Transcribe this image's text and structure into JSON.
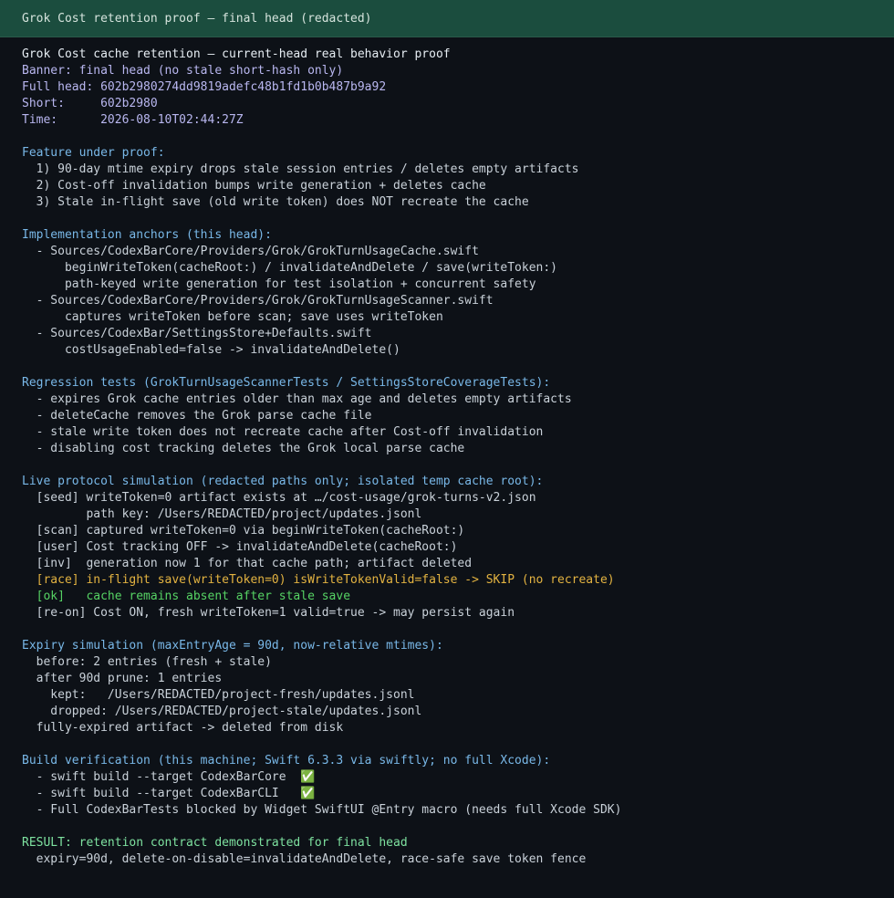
{
  "window": {
    "title": "Grok Cost retention proof — final head (redacted)"
  },
  "lines": [
    {
      "text": "Grok Cost cache retention — current-head real behavior proof",
      "color": "white"
    },
    {
      "text": "Banner: final head (no stale short-hash only)",
      "color": "lav"
    },
    {
      "text": "Full head: 602b2980274dd9819adefc48b1fd1b0b487b9a92",
      "color": "lav"
    },
    {
      "text": "Short:     602b2980",
      "color": "lav"
    },
    {
      "text": "Time:      2026-08-10T02:44:27Z",
      "color": "lav"
    },
    {
      "text": "",
      "color": "text"
    },
    {
      "text": "Feature under proof:",
      "color": "blue"
    },
    {
      "text": "  1) 90-day mtime expiry drops stale session entries / deletes empty artifacts",
      "color": "text"
    },
    {
      "text": "  2) Cost-off invalidation bumps write generation + deletes cache",
      "color": "text"
    },
    {
      "text": "  3) Stale in-flight save (old write token) does NOT recreate the cache",
      "color": "text"
    },
    {
      "text": "",
      "color": "text"
    },
    {
      "text": "Implementation anchors (this head):",
      "color": "blue"
    },
    {
      "text": "  - Sources/CodexBarCore/Providers/Grok/GrokTurnUsageCache.swift",
      "color": "text"
    },
    {
      "text": "      beginWriteToken(cacheRoot:) / invalidateAndDelete / save(writeToken:)",
      "color": "text"
    },
    {
      "text": "      path-keyed write generation for test isolation + concurrent safety",
      "color": "text"
    },
    {
      "text": "  - Sources/CodexBarCore/Providers/Grok/GrokTurnUsageScanner.swift",
      "color": "text"
    },
    {
      "text": "      captures writeToken before scan; save uses writeToken",
      "color": "text"
    },
    {
      "text": "  - Sources/CodexBar/SettingsStore+Defaults.swift",
      "color": "text"
    },
    {
      "text": "      costUsageEnabled=false -> invalidateAndDelete()",
      "color": "text"
    },
    {
      "text": "",
      "color": "text"
    },
    {
      "text": "Regression tests (GrokTurnUsageScannerTests / SettingsStoreCoverageTests):",
      "color": "blue"
    },
    {
      "text": "  - expires Grok cache entries older than max age and deletes empty artifacts",
      "color": "text"
    },
    {
      "text": "  - deleteCache removes the Grok parse cache file",
      "color": "text"
    },
    {
      "text": "  - stale write token does not recreate cache after Cost-off invalidation",
      "color": "text"
    },
    {
      "text": "  - disabling cost tracking deletes the Grok local parse cache",
      "color": "text"
    },
    {
      "text": "",
      "color": "text"
    },
    {
      "text": "Live protocol simulation (redacted paths only; isolated temp cache root):",
      "color": "blue"
    },
    {
      "text": "  [seed] writeToken=0 artifact exists at …/cost-usage/grok-turns-v2.json",
      "color": "text"
    },
    {
      "text": "         path key: /Users/REDACTED/project/updates.jsonl",
      "color": "text"
    },
    {
      "text": "  [scan] captured writeToken=0 via beginWriteToken(cacheRoot:)",
      "color": "text"
    },
    {
      "text": "  [user] Cost tracking OFF -> invalidateAndDelete(cacheRoot:)",
      "color": "text"
    },
    {
      "text": "  [inv]  generation now 1 for that cache path; artifact deleted",
      "color": "text"
    },
    {
      "text": "  [race] in-flight save(writeToken=0) isWriteTokenValid=false -> SKIP (no recreate)",
      "color": "yellow"
    },
    {
      "text": "  [ok]   cache remains absent after stale save",
      "color": "green"
    },
    {
      "text": "  [re-on] Cost ON, fresh writeToken=1 valid=true -> may persist again",
      "color": "text"
    },
    {
      "text": "",
      "color": "text"
    },
    {
      "text": "Expiry simulation (maxEntryAge = 90d, now-relative mtimes):",
      "color": "blue"
    },
    {
      "text": "  before: 2 entries (fresh + stale)",
      "color": "text"
    },
    {
      "text": "  after 90d prune: 1 entries",
      "color": "text"
    },
    {
      "text": "    kept:   /Users/REDACTED/project-fresh/updates.jsonl",
      "color": "text"
    },
    {
      "text": "    dropped: /Users/REDACTED/project-stale/updates.jsonl",
      "color": "text"
    },
    {
      "text": "  fully-expired artifact -> deleted from disk",
      "color": "text"
    },
    {
      "text": "",
      "color": "text"
    },
    {
      "text": "Build verification (this machine; Swift 6.3.3 via swiftly; no full Xcode):",
      "color": "blue"
    },
    {
      "text": "  - swift build --target CodexBarCore  ✅",
      "color": "text"
    },
    {
      "text": "  - swift build --target CodexBarCLI   ✅",
      "color": "text"
    },
    {
      "text": "  - Full CodexBarTests blocked by Widget SwiftUI @Entry macro (needs full Xcode SDK)",
      "color": "text"
    },
    {
      "text": "",
      "color": "text"
    },
    {
      "text": "RESULT: retention contract demonstrated for final head",
      "color": "result"
    },
    {
      "text": "  expiry=90d, delete-on-disable=invalidateAndDelete, race-safe save token fence",
      "color": "text"
    }
  ]
}
